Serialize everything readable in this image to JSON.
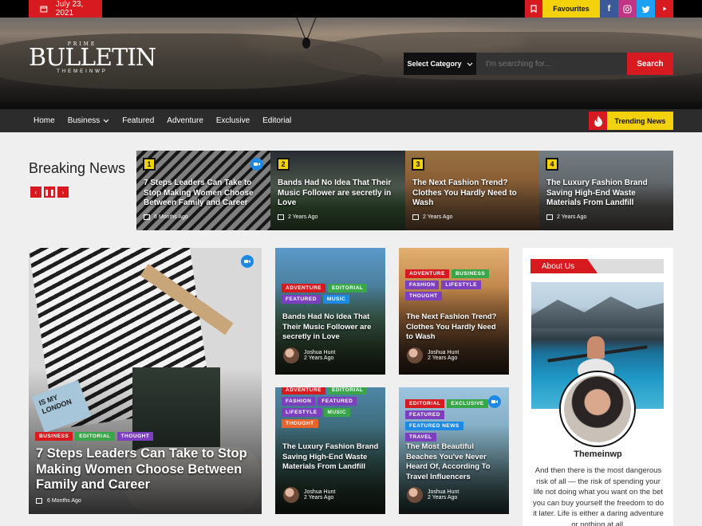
{
  "topbar": {
    "date": "July 23, 2021",
    "favourites": "Favourites",
    "socials": [
      "facebook-icon",
      "instagram-icon",
      "twitter-icon",
      "youtube-icon"
    ]
  },
  "logo": {
    "prime": "PRIME",
    "name": "BULLETIN",
    "sub": "THEMEINWP"
  },
  "search": {
    "category": "Select Category",
    "placeholder": "I'm searching for...",
    "button": "Search"
  },
  "nav": {
    "items": [
      "Home",
      "Business",
      "Featured",
      "Adventure",
      "Exclusive",
      "Editorial"
    ],
    "trending": "Trending News"
  },
  "breaking": {
    "title": "Breaking News",
    "slides": [
      {
        "num": "1",
        "title": "7 Steps Leaders Can Take to Stop Making Women Choose Between Family and Career",
        "date": "6 Months Ago"
      },
      {
        "num": "2",
        "title": "Bands Had No Idea That Their Music Follower are secretly in Love",
        "date": "2 Years Ago"
      },
      {
        "num": "3",
        "title": "The Next Fashion Trend? Clothes You Hardly Need to Wash",
        "date": "2 Years Ago"
      },
      {
        "num": "4",
        "title": "The Luxury Fashion Brand Saving High-End Waste Materials From Landfill",
        "date": "2 Years Ago"
      }
    ]
  },
  "main": {
    "tags": [
      "BUSINESS",
      "EDITORIAL",
      "THOUGHT"
    ],
    "title": "7 Steps Leaders Can Take to Stop Making Women Choose Between Family and Career",
    "date": "6 Months Ago",
    "book_text": "IS MY\nLONDON"
  },
  "cards": [
    {
      "tags": [
        "ADVENTURE",
        "EDITORIAL",
        "FEATURED",
        "MUSIC"
      ],
      "title": "Bands Had No Idea That Their Music Follower are secretly in Love",
      "author": "Joshua Hunt",
      "date": "2 Years Ago"
    },
    {
      "tags": [
        "ADVENTURE",
        "BUSINESS",
        "FASHION",
        "LIFESTYLE",
        "THOUGHT"
      ],
      "title": "The Next Fashion Trend? Clothes You Hardly Need to Wash",
      "author": "Joshua Hunt",
      "date": "2 Years Ago"
    },
    {
      "tags": [
        "ADVENTURE",
        "EDITORIAL",
        "FASHION",
        "FEATURED",
        "LIFESTYLE",
        "MUSIC",
        "THOUGHT"
      ],
      "title": "The Luxury Fashion Brand Saving High-End Waste Materials From Landfill",
      "author": "Joshua Hunt",
      "date": "2 Years Ago"
    },
    {
      "tags": [
        "EDITORIAL",
        "EXCLUSIVE",
        "FEATURED",
        "FEATURED NEWS",
        "TRAVEL"
      ],
      "title": "The Most Beautiful Beaches You've Never Heard Of, According To Travel Influencers",
      "author": "Joshua Hunt",
      "date": "2 Years Ago"
    }
  ],
  "about": {
    "heading": "About Us",
    "name": "Themeinwp",
    "text": "And then there is the most dangerous risk of all — the risk of spending your life not doing what you want on the bet you can buy yourself the freedom to do it later. Life is either a daring adventure or nothing at all."
  },
  "colors": {
    "accent": "#d71920",
    "yellow": "#f4d20b",
    "BUSINESS": "#d71920",
    "EDITORIAL": "#3aa64a",
    "THOUGHT": "#7b3fbf",
    "ADVENTURE": "#d71920",
    "FEATURED": "#7b3fbf",
    "MUSIC": "#1e88e5",
    "FASHION": "#7b3fbf",
    "LIFESTYLE": "#7b3fbf",
    "EXCLUSIVE": "#3aa64a",
    "FEATURED NEWS": "#1e88e5",
    "TRAVEL": "#7b3fbf"
  }
}
